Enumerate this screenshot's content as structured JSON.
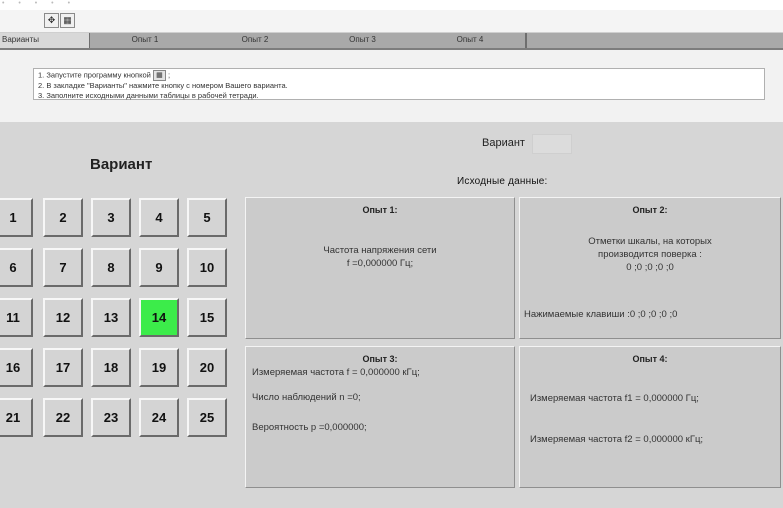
{
  "toolbar": {
    "buttons": [
      {
        "icon": "arrows-icon",
        "glyph": "✥"
      },
      {
        "icon": "grid-icon",
        "glyph": "▦"
      }
    ]
  },
  "tabs": [
    "Варианты",
    "Опыт 1",
    "Опыт 2",
    "Опыт 3",
    "Опыт 4"
  ],
  "instructions": {
    "line1": "1. Запустите программу кнопкой",
    "line1_end": ";",
    "line2": "2. В закладке \"Варианты\" нажмите кнопку с номером Вашего варианта.",
    "line3": "3. Заполните исходными данными таблицы в рабочей тетради."
  },
  "variants": {
    "heading": "Вариант",
    "numbers": [
      "1",
      "2",
      "3",
      "4",
      "5",
      "6",
      "7",
      "8",
      "9",
      "10",
      "11",
      "12",
      "13",
      "14",
      "15",
      "16",
      "17",
      "18",
      "19",
      "20",
      "21",
      "22",
      "23",
      "24",
      "25"
    ],
    "selected": "14",
    "active_color": "#3cec4a"
  },
  "info": {
    "variant_label": "Вариант",
    "initial_data_label": "Исходные данные:"
  },
  "panels": {
    "exp1": {
      "title": "Опыт 1:",
      "line1": "Частота напряжения сети",
      "line2": "f =0,000000 Гц;"
    },
    "exp2": {
      "title": "Опыт 2:",
      "line1": "Отметки шкалы, на которых",
      "line2": "производится поверка :",
      "line3": "0  ;0  ;0  ;0  ;0",
      "line4": "Нажимаемые клавиши :0  ;0  ;0  ;0  ;0"
    },
    "exp3": {
      "title": "Опыт 3:",
      "line1": "Измеряемая частота f = 0,000000 кГц;",
      "line2": "Число наблюдений  n =0;",
      "line3": "Вероятность  p =0,000000;"
    },
    "exp4": {
      "title": "Опыт 4:",
      "line1": "Измеряемая частота  f1 = 0,000000 Гц;",
      "line2": "Измеряемая частота  f2 = 0,000000 кГц;"
    }
  }
}
